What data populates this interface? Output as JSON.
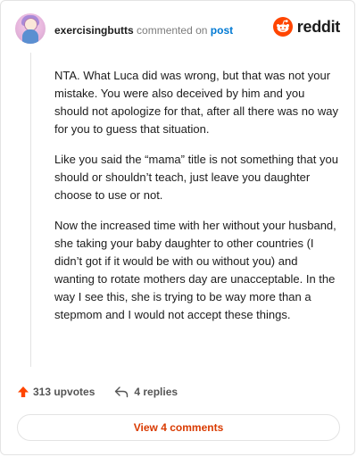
{
  "header": {
    "username": "exercisingbutts",
    "commented_on": "commented on",
    "post_link": "post",
    "logo_text": "reddit"
  },
  "comment": {
    "paragraphs": [
      "NTA. What Luca did was wrong, but that was not your mistake. You were also deceived by him and you should not apologize for that, after all there was no way for you to guess that situation.",
      "Like you said the “mama” title is not something that you should or shouldn’t teach, just leave you daughter choose to use or not.",
      "Now the increased time with her without your husband, she taking your baby daughter to other countries (I didn’t got if it would be with ou without you) and wanting to rotate mothers day are unacceptable. In the way I see this, she is trying to be way more than a stepmom and I would not accept these things."
    ]
  },
  "actions": {
    "upvotes": "313 upvotes",
    "replies": "4 replies"
  },
  "footer": {
    "view_button": "View 4 comments"
  },
  "colors": {
    "brand": "#ff4500",
    "link": "#0079d3",
    "view_button_text": "#d93a00"
  },
  "icons": [
    "user-avatar",
    "reddit-logo-icon",
    "upvote-arrow-icon",
    "reply-arrow-icon"
  ]
}
